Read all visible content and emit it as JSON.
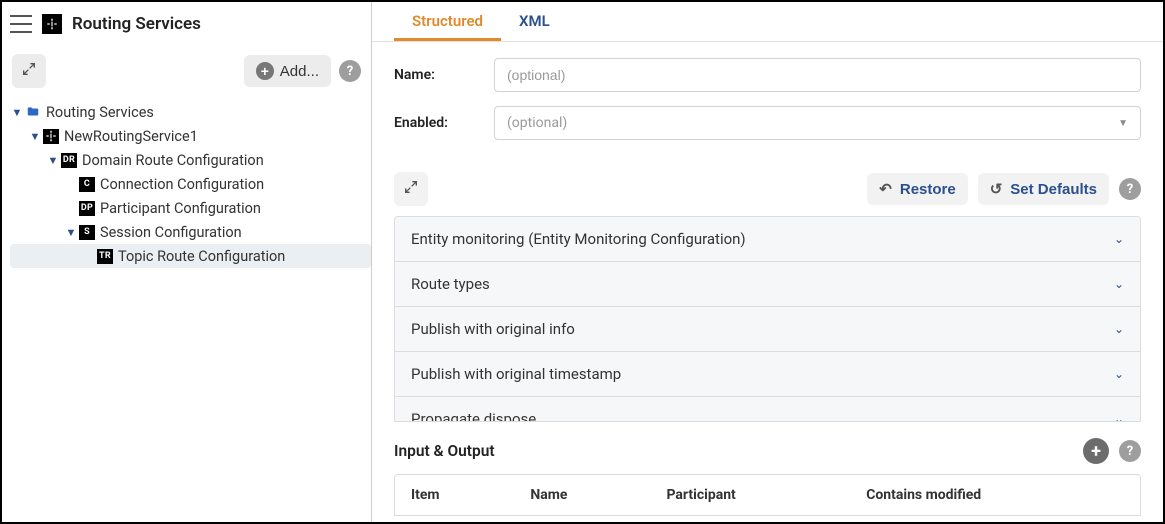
{
  "sidebar": {
    "title": "Routing Services",
    "add_label": "Add...",
    "tree": {
      "root": {
        "label": "Routing Services"
      },
      "service": {
        "label": "NewRoutingService1"
      },
      "domain_route": {
        "label": "Domain Route Configuration",
        "badge": "DR"
      },
      "connection": {
        "label": "Connection Configuration",
        "badge": "C"
      },
      "participant": {
        "label": "Participant Configuration",
        "badge": "DP"
      },
      "session": {
        "label": "Session Configuration",
        "badge": "S"
      },
      "topic_route": {
        "label": "Topic Route Configuration",
        "badge": "TR"
      }
    }
  },
  "tabs": {
    "structured": "Structured",
    "xml": "XML"
  },
  "form": {
    "name_label": "Name:",
    "name_placeholder": "(optional)",
    "enabled_label": "Enabled:",
    "enabled_placeholder": "(optional)"
  },
  "panel_toolbar": {
    "restore": "Restore",
    "set_defaults": "Set Defaults"
  },
  "accordion": [
    "Entity monitoring (Entity Monitoring Configuration)",
    "Route types",
    "Publish with original info",
    "Publish with original timestamp",
    "Propagate dispose"
  ],
  "io": {
    "title": "Input & Output",
    "columns": [
      "Item",
      "Name",
      "Participant",
      "Contains modified"
    ]
  }
}
